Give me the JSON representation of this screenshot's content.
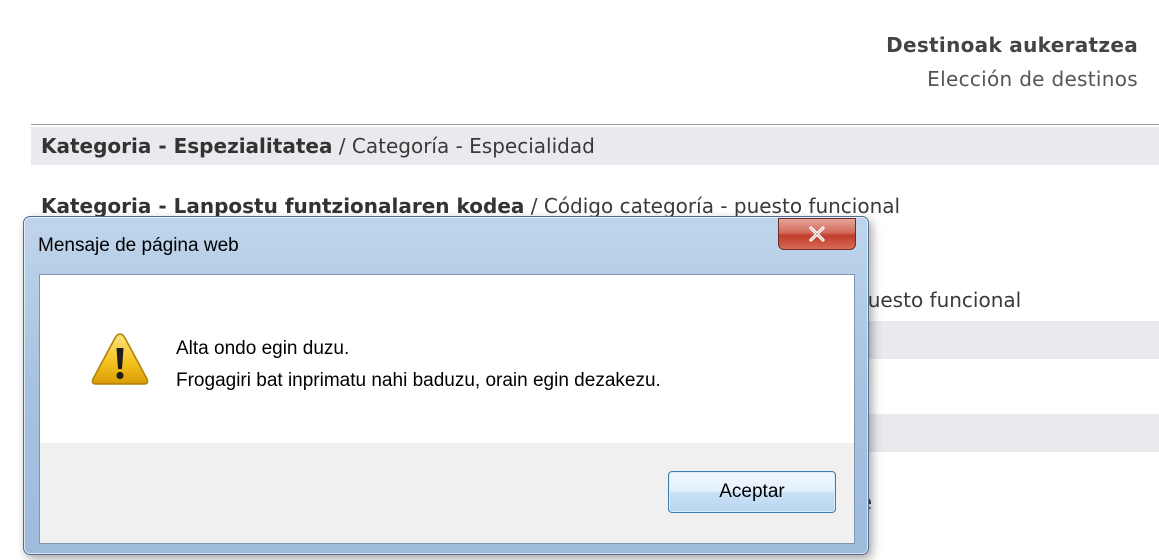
{
  "header": {
    "title": "Destinoak aukeratzea",
    "subtitle": "Elección de destinos"
  },
  "rows": [
    {
      "bold": "Kategoria - Espezialitatea",
      "separator": " / ",
      "normal": "Categoría - Especialidad"
    },
    {
      "bold": "Kategoria - Lanpostu funtzionalaren kodea",
      "separator": " / ",
      "normal": "Código categoría - puesto funcional"
    }
  ],
  "background_fragments": {
    "row3_tail": "puesto funcional",
    "row6_tail": "re"
  },
  "dialog": {
    "title": "Mensaje de página web",
    "close_icon": "close-x-icon",
    "warning_icon": "warning-triangle-icon",
    "message_line1": "Alta ondo egin duzu.",
    "message_line2": "Frogagiri bat inprimatu nahi baduzu, orain egin dezakezu.",
    "ok_button": "Aceptar"
  },
  "colors": {
    "row_band": "#e9eaee",
    "dialog_frame": "#a7c2e0",
    "close_button": "#c03e2d",
    "warning_fill": "#f2c11c"
  }
}
